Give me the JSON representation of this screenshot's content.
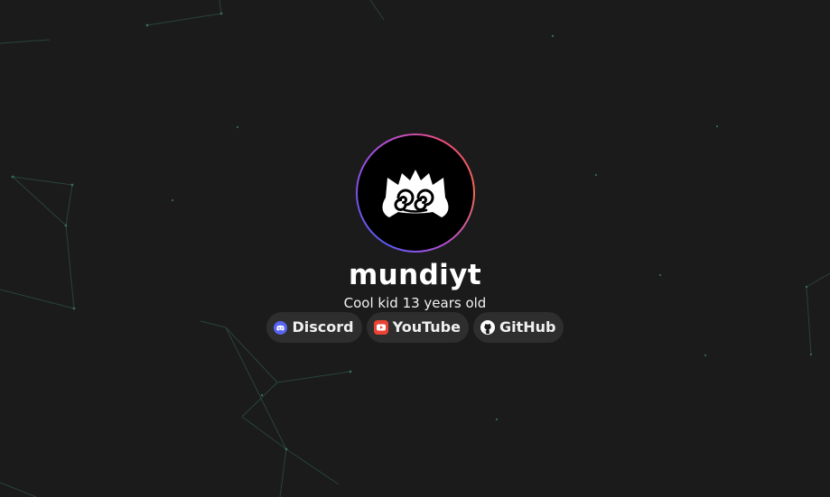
{
  "profile": {
    "username": "mundiyt",
    "bio": "Cool kid 13 years old",
    "avatar": {
      "icon": "discord-dizzy-face-icon",
      "ring_colors": [
        "#5b5cf2",
        "#b24ed3",
        "#f04c7a"
      ]
    }
  },
  "links": [
    {
      "label": "Discord",
      "icon": "discord-icon",
      "color": "#5865F2"
    },
    {
      "label": "YouTube",
      "icon": "youtube-icon",
      "color": "#FF0000"
    },
    {
      "label": "GitHub",
      "icon": "github-icon",
      "color": "#FFFFFF"
    }
  ],
  "theme": {
    "background": "#1b1b1b",
    "button_background": "#2e2e2e",
    "particle_line_color": "#2c4a40"
  }
}
